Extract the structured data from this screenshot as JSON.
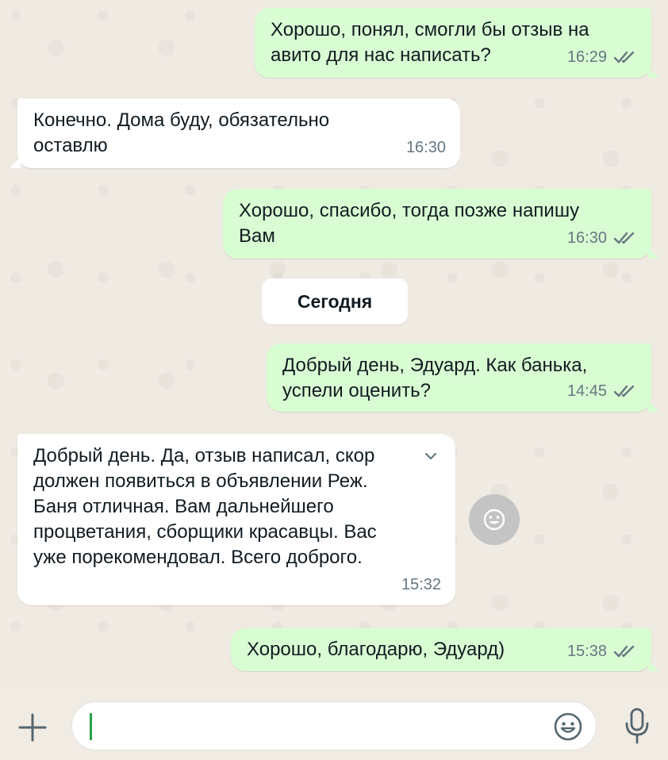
{
  "messages": [
    {
      "text": "Хорошо, понял, смогли бы отзыв на\nавито для нас написать?",
      "time": "16:29"
    },
    {
      "text": "Конечно. Дома буду, обязательно\nоставлю",
      "time": "16:30"
    },
    {
      "text": "Хорошо, спасибо, тогда позже напишу\nВам",
      "time": "16:30"
    },
    {
      "text": "Добрый день, Эдуард. Как банька,\nуспели оценить?",
      "time": "14:45"
    },
    {
      "text": "Добрый день. Да, отзыв написал, скор\nдолжен появиться в объявлении Реж.\nБаня отличная. Вам дальнейшего\nпроцветания, сборщики красавцы. Вас\nуже порекомендовал. Всего доброго.",
      "time": "15:32"
    },
    {
      "text": "Хорошо, благодарю, Эдуард)",
      "time": "15:38"
    }
  ],
  "date_separator": "Сегодня",
  "composer": {
    "placeholder": "",
    "value": ""
  },
  "icons": {
    "attach": "plus-icon",
    "emoji": "emoji-icon",
    "mic": "microphone-icon",
    "read_receipt": "double-check-icon",
    "chevron": "chevron-down-icon",
    "reaction": "emoji-reaction-icon"
  },
  "colors": {
    "outgoing_bubble": "#d9fdd3",
    "incoming_bubble": "#ffffff",
    "chat_background": "#efeae2",
    "read_ticks": "#667781",
    "caret": "#25a244"
  }
}
